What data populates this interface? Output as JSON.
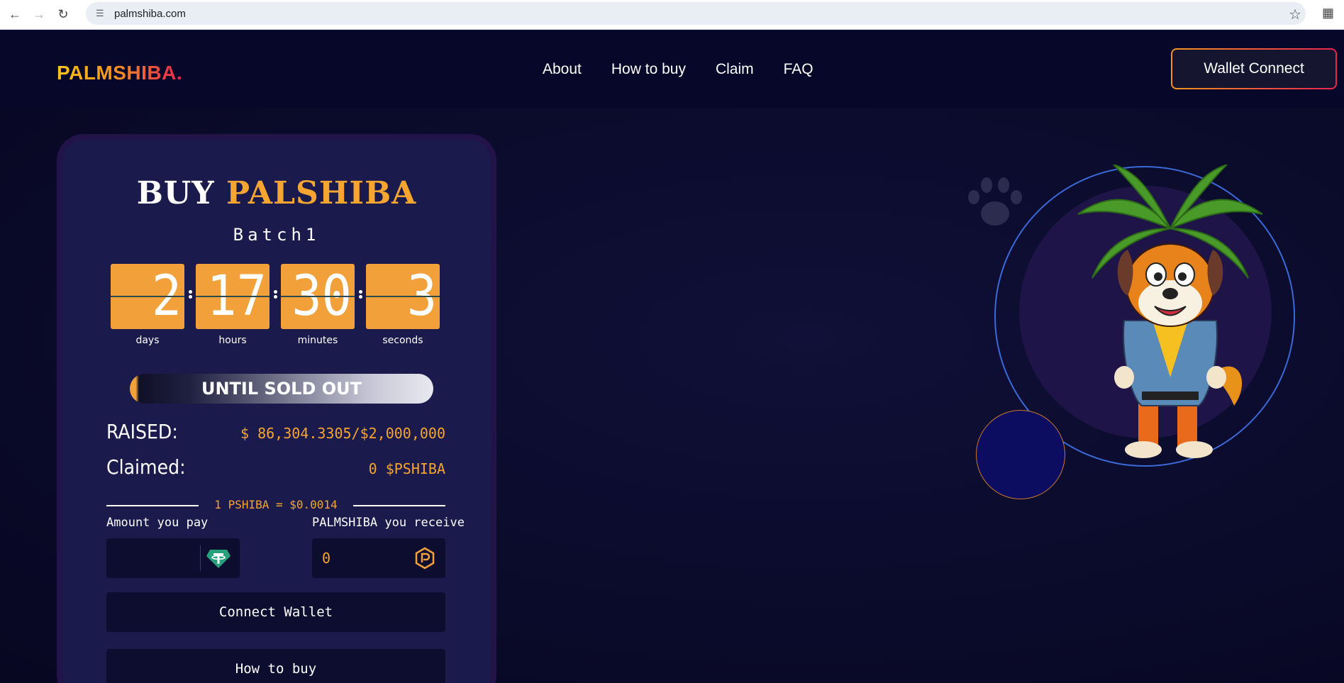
{
  "browser": {
    "url": "palmshiba.com"
  },
  "header": {
    "logo": "PALMSHIBA.",
    "nav": [
      "About",
      "How to buy",
      "Claim",
      "FAQ"
    ],
    "wallet_button": "Wallet Connect"
  },
  "buy_card": {
    "title_white": "BUY",
    "title_orange": "PALSHIBA",
    "batch": "Batch1",
    "countdown": [
      {
        "value": "2",
        "label": "days"
      },
      {
        "value": "17",
        "label": "hours"
      },
      {
        "value": "30",
        "label": "minutes"
      },
      {
        "value": "3",
        "label": "seconds"
      }
    ],
    "sold_out": "UNTIL SOLD OUT",
    "raised_label": "RAISED:",
    "raised_value": "$ 86,304.3305/$2,000,000",
    "claimed_label": "Claimed:",
    "claimed_value": "0 $PSHIBA",
    "rate": "1 PSHIBA = $0.0014",
    "pay_label": "Amount you pay",
    "pay_value": "",
    "receive_label": "PALMSHIBA you receive",
    "receive_value": "0",
    "connect_button": "Connect Wallet",
    "how_button": "How to buy"
  },
  "icons": {
    "pay_token": "tether-icon",
    "receive_token": "palmshiba-token-icon"
  },
  "colors": {
    "accent": "#f5a530",
    "background": "#0a0a2a",
    "card": "#1a1a4c"
  }
}
